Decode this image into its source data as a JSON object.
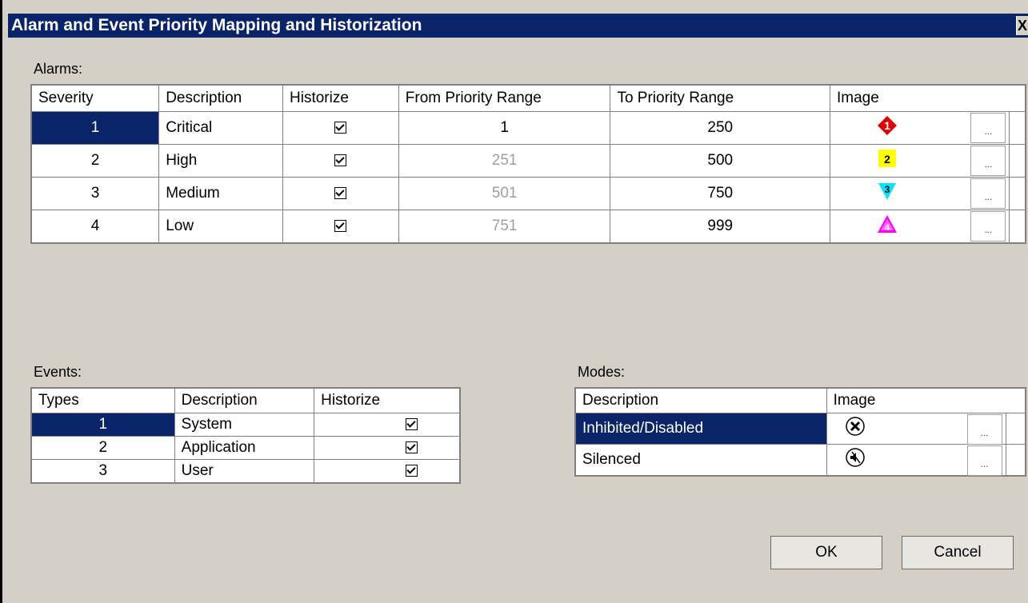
{
  "window": {
    "title": "Alarm and Event Priority Mapping and Historization",
    "close": "X"
  },
  "alarms": {
    "label": "Alarms:",
    "headers": [
      "Severity",
      "Description",
      "Historize",
      "From Priority Range",
      "To Priority Range",
      "Image"
    ],
    "rows": [
      {
        "severity": "1",
        "description": "Critical",
        "historize": true,
        "from": "1",
        "to": "250",
        "icon": "red-diamond-1-icon",
        "icon_text": "1",
        "dots": "..."
      },
      {
        "severity": "2",
        "description": "High",
        "historize": true,
        "from": "251",
        "to": "500",
        "icon": "yellow-square-2-icon",
        "icon_text": "2",
        "dots": "..."
      },
      {
        "severity": "3",
        "description": "Medium",
        "historize": true,
        "from": "501",
        "to": "750",
        "icon": "cyan-triangle-down-3-icon",
        "icon_text": "3",
        "dots": "..."
      },
      {
        "severity": "4",
        "description": "Low",
        "historize": true,
        "from": "751",
        "to": "999",
        "icon": "magenta-triangle-up-4-icon",
        "icon_text": "4",
        "dots": "..."
      }
    ]
  },
  "events": {
    "label": "Events:",
    "headers": [
      "Types",
      "Description",
      "Historize"
    ],
    "rows": [
      {
        "type": "1",
        "description": "System",
        "historize": true
      },
      {
        "type": "2",
        "description": "Application",
        "historize": true
      },
      {
        "type": "3",
        "description": "User",
        "historize": true
      }
    ]
  },
  "modes": {
    "label": "Modes:",
    "headers": [
      "Description",
      "Image"
    ],
    "rows": [
      {
        "description": "Inhibited/Disabled",
        "icon": "inhibited-x-icon",
        "dots": "..."
      },
      {
        "description": "Silenced",
        "icon": "silenced-speaker-icon",
        "dots": "..."
      }
    ]
  },
  "buttons": {
    "ok": "OK",
    "cancel": "Cancel"
  },
  "colors": {
    "selection": "#0a246a",
    "dialog": "#d4d0c8"
  }
}
